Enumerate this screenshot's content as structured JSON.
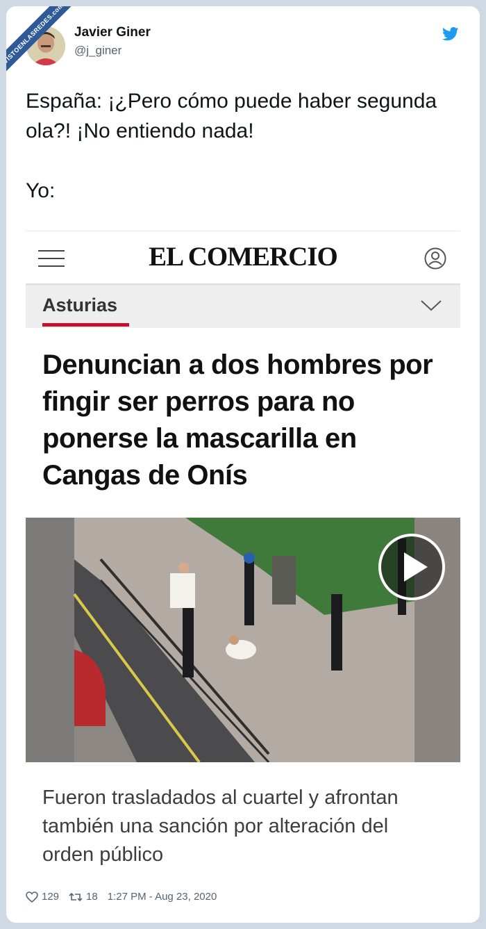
{
  "watermark": {
    "text": "VISTOENLASREDES",
    "subtext": ".com"
  },
  "tweet": {
    "author_name": "Javier Giner",
    "author_handle": "@j_giner",
    "text_line1": "España: ¡¿Pero cómo puede haber segunda ola?! ¡No entiendo nada!",
    "text_line2": "Yo:",
    "likes": "129",
    "retweets": "18",
    "timestamp": "1:27 PM - Aug 23, 2020"
  },
  "embed": {
    "logo": "EL COMERCIO",
    "section": "Asturias",
    "headline": "Denuncian a dos hombres por fingir ser perros para no ponerse la mascarilla en Cangas de Onís",
    "caption": "Fueron trasladados al cuartel y afrontan también una sanción por alteración del orden público"
  },
  "colors": {
    "twitter_blue": "#1d9bf0",
    "accent_red": "#c8102e",
    "ribbon_blue": "#2e5b97"
  }
}
